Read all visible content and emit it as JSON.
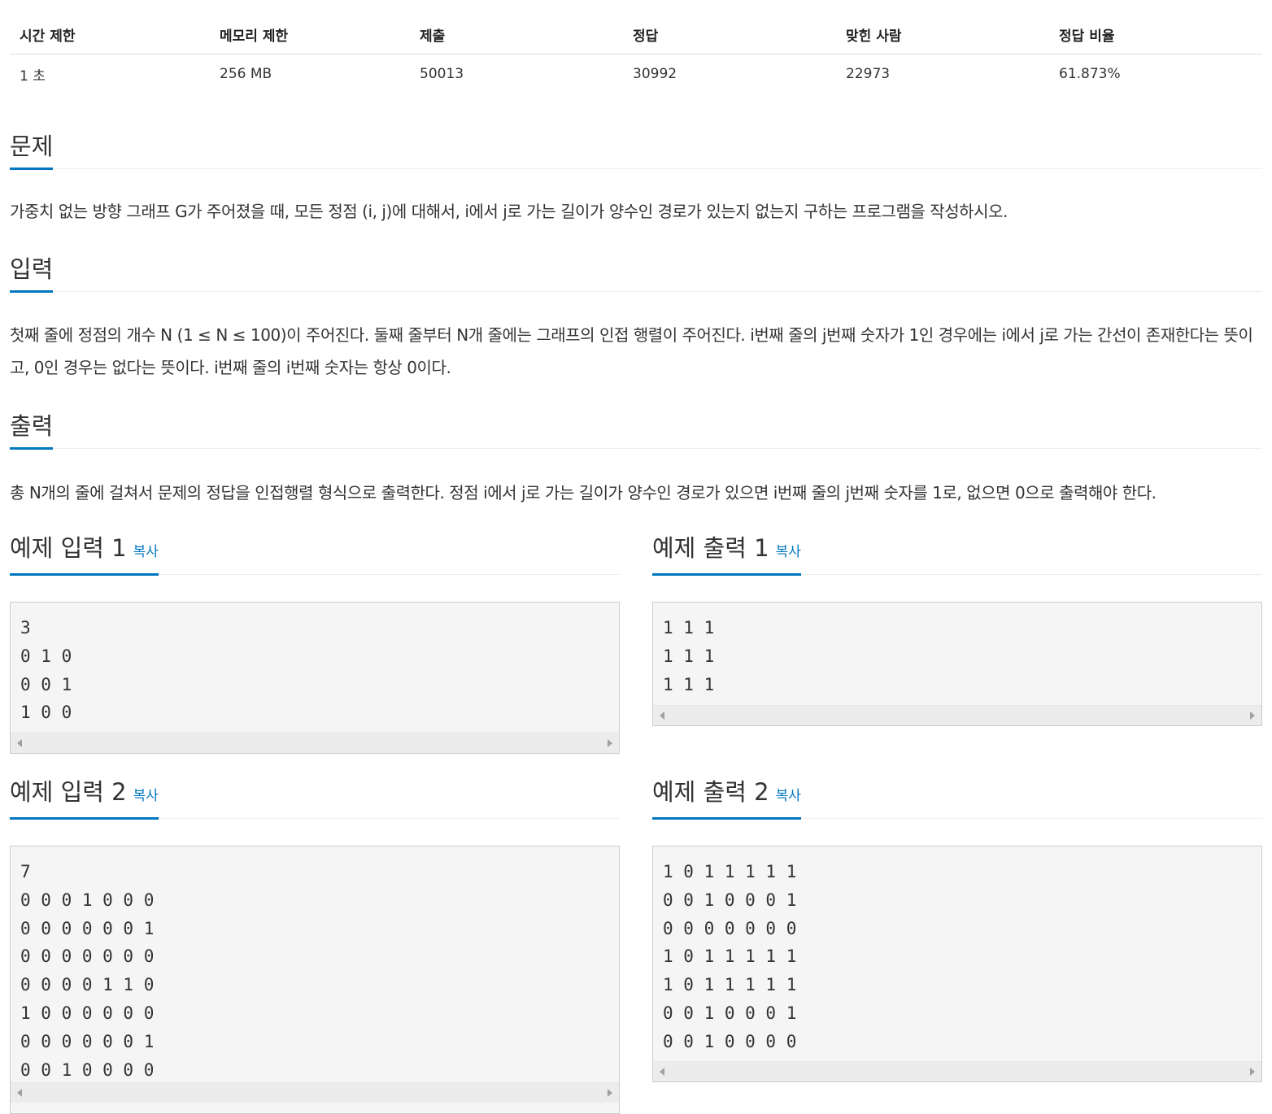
{
  "stats": {
    "headers": [
      "시간 제한",
      "메모리 제한",
      "제출",
      "정답",
      "맞힌 사람",
      "정답 비율"
    ],
    "values": [
      "1 초",
      "256 MB",
      "50013",
      "30992",
      "22973",
      "61.873%"
    ]
  },
  "problem": {
    "title": "문제",
    "text": "가중치 없는 방향 그래프 G가 주어졌을 때, 모든 정점 (i, j)에 대해서, i에서 j로 가는 길이가 양수인 경로가 있는지 없는지 구하는 프로그램을 작성하시오."
  },
  "input": {
    "title": "입력",
    "text": "첫째 줄에 정점의 개수 N (1 ≤ N ≤ 100)이 주어진다. 둘째 줄부터 N개 줄에는 그래프의 인접 행렬이 주어진다. i번째 줄의 j번째 숫자가 1인 경우에는 i에서 j로 가는 간선이 존재한다는 뜻이고, 0인 경우는 없다는 뜻이다. i번째 줄의 i번째 숫자는 항상 0이다."
  },
  "output": {
    "title": "출력",
    "text": "총 N개의 줄에 걸쳐서 문제의 정답을 인접행렬 형식으로 출력한다. 정점 i에서 j로 가는 길이가 양수인 경로가 있으면 i번째 줄의 j번째 숫자를 1로, 없으면 0으로 출력해야 한다."
  },
  "copy_label": "복사",
  "samples": {
    "in1": {
      "title": "예제 입력 1",
      "content": "3\n0 1 0\n0 0 1\n1 0 0"
    },
    "out1": {
      "title": "예제 출력 1",
      "content": "1 1 1\n1 1 1\n1 1 1"
    },
    "in2": {
      "title": "예제 입력 2",
      "content": "7\n0 0 0 1 0 0 0\n0 0 0 0 0 0 1\n0 0 0 0 0 0 0\n0 0 0 0 1 1 0\n1 0 0 0 0 0 0\n0 0 0 0 0 0 1\n0 0 1 0 0 0 0"
    },
    "out2": {
      "title": "예제 출력 2",
      "content": "1 0 1 1 1 1 1\n0 0 1 0 0 0 1\n0 0 0 0 0 0 0\n1 0 1 1 1 1 1\n1 0 1 1 1 1 1\n0 0 1 0 0 0 1\n0 0 1 0 0 0 0"
    }
  }
}
